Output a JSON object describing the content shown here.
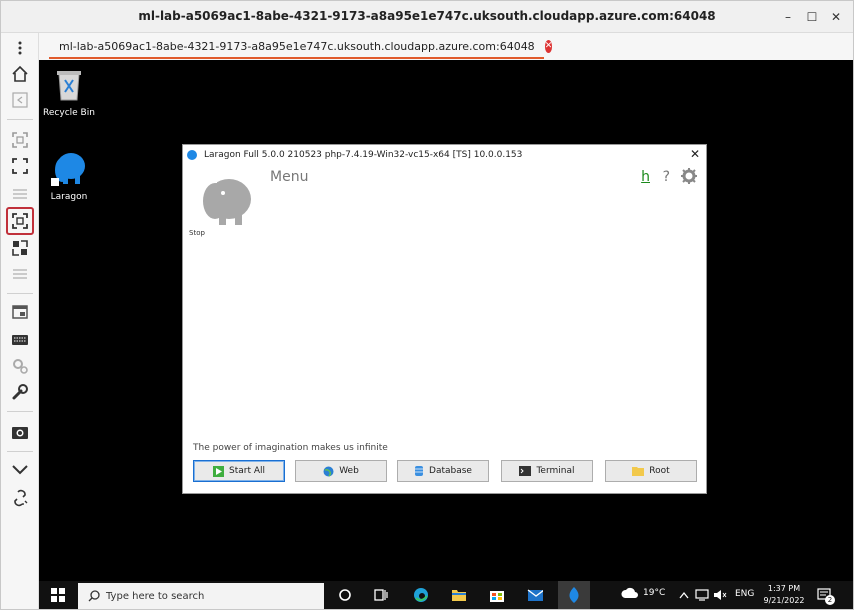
{
  "window": {
    "title": "ml-lab-a5069ac1-8abe-4321-9173-a8a95e1e747c.uksouth.cloudapp.azure.com:64048",
    "minimize": "–",
    "maximize": "☐",
    "close": "✕"
  },
  "tab": {
    "label": "ml-lab-a5069ac1-8abe-4321-9173-a8a95e1e747c.uksouth.cloudapp.azure.com:64048",
    "close": "✕"
  },
  "desktop_icons": [
    {
      "label": "Recycle Bin",
      "icon": "recycle-bin-icon"
    },
    {
      "label": "Laragon",
      "icon": "laragon-icon"
    }
  ],
  "dialog": {
    "title": "Laragon Full 5.0.0 210523 php-7.4.19-Win32-vc15-x64 [TS] 10.0.0.153",
    "close": "✕",
    "menu": "Menu",
    "h_link": "h",
    "help": "?",
    "stop_label": "Stop",
    "slogan": "The power of imagination makes us infinite",
    "buttons": [
      {
        "label": "Start All",
        "icon": "play-icon"
      },
      {
        "label": "Web",
        "icon": "globe-icon"
      },
      {
        "label": "Database",
        "icon": "database-icon"
      },
      {
        "label": "Terminal",
        "icon": "terminal-icon"
      },
      {
        "label": "Root",
        "icon": "folder-icon"
      }
    ]
  },
  "taskbar": {
    "search_placeholder": "Type here to search",
    "weather": "19°C",
    "lang": "ENG",
    "time": "1:37 PM",
    "date": "9/21/2022",
    "notifications": "2"
  },
  "colors": {
    "accent_red": "#c0303a",
    "tab_underline": "#e05a2c",
    "laragon_blue": "#1e88e5",
    "taskbar_bg": "#111111"
  }
}
